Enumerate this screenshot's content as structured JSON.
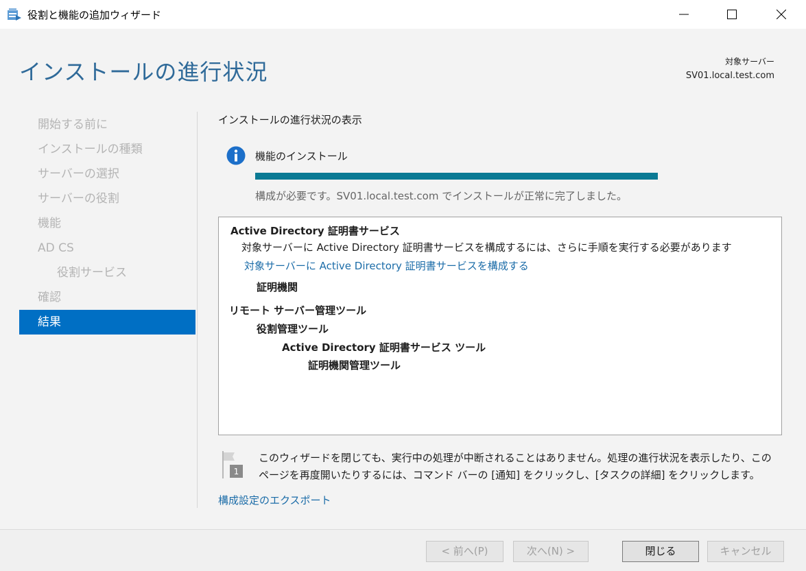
{
  "window": {
    "title": "役割と機能の追加ウィザード",
    "icon": "server-manager-wizard-icon"
  },
  "header": {
    "heading": "インストールの進行状況",
    "target_label": "対象サーバー",
    "target_value": "SV01.local.test.com"
  },
  "nav": {
    "items": [
      {
        "label": "開始する前に"
      },
      {
        "label": "インストールの種類"
      },
      {
        "label": "サーバーの選択"
      },
      {
        "label": "サーバーの役割"
      },
      {
        "label": "機能"
      },
      {
        "label": "AD CS"
      },
      {
        "label": "役割サービス"
      },
      {
        "label": "確認"
      },
      {
        "label": "結果"
      }
    ],
    "active_index": 8
  },
  "main": {
    "section_label": "インストールの進行状況の表示",
    "feature_title": "機能のインストール",
    "progress_fraction": 1.0,
    "progress_color": "#0b7a94",
    "status_text": "構成が必要です。SV01.local.test.com でインストールが正常に完了しました。",
    "results": [
      {
        "text": "Active Directory 証明書サービス"
      },
      {
        "text": "対象サーバーに Active Directory 証明書サービスを構成するには、さらに手順を実行する必要があります"
      },
      {
        "text": "対象サーバーに Active Directory 証明書サービスを構成する"
      },
      {
        "text": "証明機関"
      },
      {
        "text": "リモート サーバー管理ツール"
      },
      {
        "text": "役割管理ツール"
      },
      {
        "text": "Active Directory 証明書サービス ツール"
      },
      {
        "text": "証明機関管理ツール"
      }
    ],
    "note": {
      "icon_badge": "1",
      "text": "このウィザードを閉じても、実行中の処理が中断されることはありません。処理の進行状況を表示したり、このページを再度開いたりするには、コマンド バーの [通知] をクリックし、[タスクの詳細] をクリックします。"
    },
    "export_link": "構成設定のエクスポート"
  },
  "footer": {
    "prev": "< 前へ(P)",
    "next": "次へ(N) >",
    "close": "閉じる",
    "cancel": "キャンセル"
  },
  "colors": {
    "heading": "#2f6a99",
    "nav_active_bg": "#006fc4",
    "link": "#1b6ca8",
    "info_icon": "#1c6fc9"
  }
}
